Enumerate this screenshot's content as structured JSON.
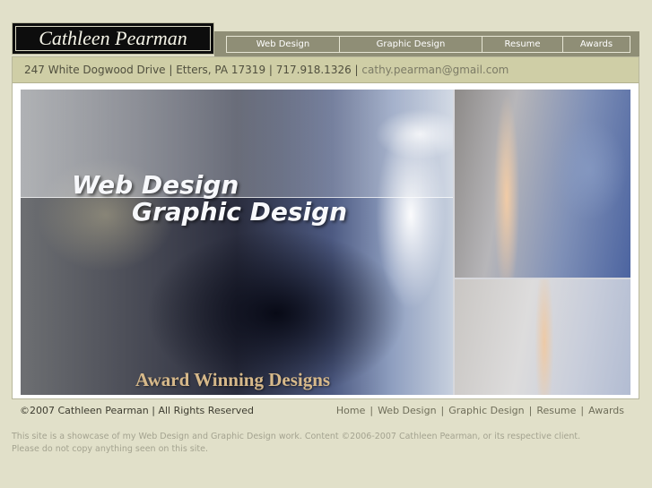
{
  "logo": {
    "text": "Cathleen Pearman"
  },
  "nav": [
    {
      "label": "Web Design"
    },
    {
      "label": "Graphic Design"
    },
    {
      "label": "Resume"
    },
    {
      "label": "Awards"
    }
  ],
  "contact": {
    "address": "247 White Dogwood Drive | Etters, PA 17319 | 717.918.1326 | ",
    "email": "cathy.pearman@gmail.com"
  },
  "banner": {
    "line1": "Web Design",
    "line2": "Graphic Design",
    "tagline": "Award Winning Designs"
  },
  "footer": {
    "copyright": "©2007 Cathleen Pearman | All Rights Reserved",
    "links": [
      {
        "label": "Home"
      },
      {
        "label": "Web Design"
      },
      {
        "label": "Graphic Design"
      },
      {
        "label": "Resume"
      },
      {
        "label": "Awards"
      }
    ],
    "separator": "|",
    "disclaimer_line1": "This site is a showcase of my Web Design and Graphic Design work. Content ©2006-2007 Cathleen Pearman, or its respective client.",
    "disclaimer_line2": "Please do not copy anything seen on this site."
  }
}
